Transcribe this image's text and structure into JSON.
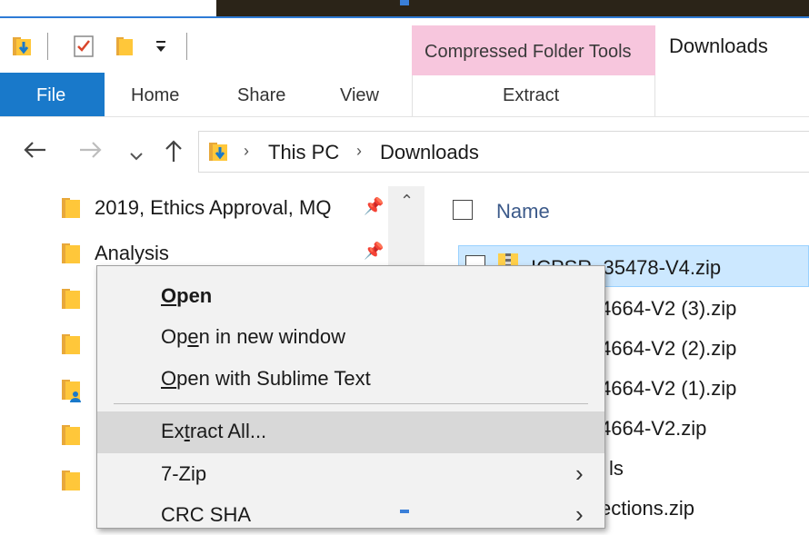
{
  "window": {
    "title": "Downloads"
  },
  "ribbon": {
    "context_group": "Compressed Folder Tools",
    "tabs": [
      "File",
      "Home",
      "Share",
      "View"
    ],
    "context_tab": "Extract",
    "accent": "#1979ca",
    "context_color": "#f7c6dd"
  },
  "address": {
    "crumbs": [
      "This PC",
      "Downloads"
    ]
  },
  "nav_pane": {
    "items": [
      {
        "label": "2019, Ethics Approval, MQ",
        "pinned": true
      },
      {
        "label": "Analysis",
        "pinned": true
      }
    ]
  },
  "file_list": {
    "column_header": "Name",
    "files": [
      {
        "name": "ICPSR_35478-V4.zip",
        "selected": true
      },
      {
        "name": "4664-V2 (3).zip"
      },
      {
        "name": "4664-V2 (2).zip"
      },
      {
        "name": "4664-V2 (1).zip"
      },
      {
        "name": "4664-V2.zip"
      },
      {
        "name": "ls"
      },
      {
        "name": "ections.zip"
      }
    ]
  },
  "context_menu": {
    "items": [
      {
        "pre": "",
        "accel": "O",
        "post": "pen",
        "bold": true
      },
      {
        "pre": "Op",
        "accel": "e",
        "post": "n in new window"
      },
      {
        "pre": "",
        "accel": "O",
        "post": "pen with Sublime Text"
      },
      {
        "pre": "Ex",
        "accel": "t",
        "post": "ract All...",
        "highlighted": true
      },
      {
        "pre": "7-Zip",
        "accel": "",
        "post": "",
        "submenu": true
      },
      {
        "pre": "CRC SHA",
        "accel": "",
        "post": "",
        "submenu": true
      }
    ]
  },
  "icons": {
    "back": "left-arrow-icon",
    "forward": "right-arrow-icon",
    "recent": "chevron-down-icon",
    "up": "up-arrow-icon",
    "pin": "pin-icon",
    "folder": "folder-icon",
    "zip": "zip-folder-icon"
  }
}
